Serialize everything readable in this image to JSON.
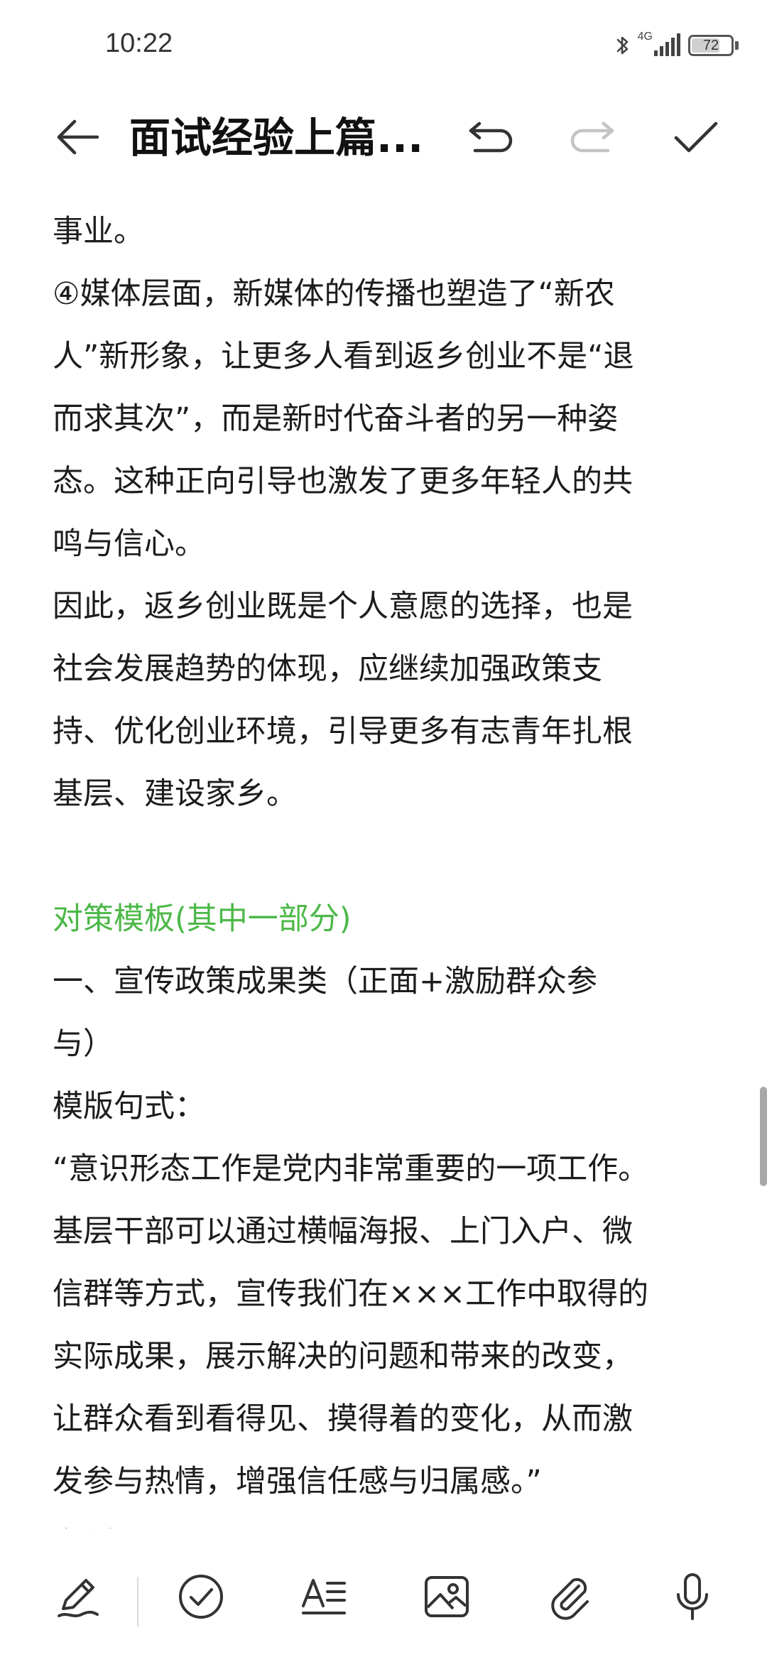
{
  "status_bar": {
    "time": "10:22",
    "network": "4G",
    "battery_level": "72",
    "battery_fraction": 0.72
  },
  "title_bar": {
    "title": "面试经验上篇..."
  },
  "content": {
    "lines": [
      {
        "text": "事业。",
        "style": "normal"
      },
      {
        "text": "④媒体层面，新媒体的传播也塑造了“新农",
        "style": "normal"
      },
      {
        "text": "人”新形象，让更多人看到返乡创业不是“退",
        "style": "normal"
      },
      {
        "text": "而求其次”，而是新时代奋斗者的另一种姿",
        "style": "normal"
      },
      {
        "text": "态。这种正向引导也激发了更多年轻人的共",
        "style": "normal"
      },
      {
        "text": "鸣与信心。",
        "style": "normal"
      },
      {
        "text": "因此，返乡创业既是个人意愿的选择，也是",
        "style": "normal"
      },
      {
        "text": "社会发展趋势的体现，应继续加强政策支",
        "style": "normal"
      },
      {
        "text": "持、优化创业环境，引导更多有志青年扎根",
        "style": "normal"
      },
      {
        "text": "基层、建设家乡。",
        "style": "normal"
      },
      {
        "text": "",
        "style": "blank"
      },
      {
        "text": "对策模板(其中一部分)",
        "style": "heading"
      },
      {
        "text": "一、宣传政策成果类（正面+激励群众参",
        "style": "normal"
      },
      {
        "text": "与）",
        "style": "normal"
      },
      {
        "text": "模版句式：",
        "style": "normal"
      },
      {
        "text": "“意识形态工作是党内非常重要的一项工作。",
        "style": "normal"
      },
      {
        "text": "基层干部可以通过横幅海报、上门入户、微",
        "style": "normal"
      },
      {
        "text": "信群等方式，宣传我们在×××工作中取得的",
        "style": "normal"
      },
      {
        "text": "实际成果，展示解决的问题和带来的改变，",
        "style": "normal"
      },
      {
        "text": "让群众看到看得见、摸得着的变化，从而激",
        "style": "normal"
      },
      {
        "text": "发参与热情，增强信任感与归属感。”",
        "style": "normal"
      },
      {
        "text": "举例：",
        "style": "normal"
      }
    ]
  },
  "colors": {
    "heading": "#4cb848",
    "text": "#1c1c1c",
    "icon": "#333333",
    "icon_disabled": "#c4c4c4"
  },
  "icons": {
    "back": "arrow-left-icon",
    "undo": "undo-icon",
    "redo": "redo-icon",
    "done": "check-icon",
    "pen": "pen-icon",
    "checklist": "check-circle-icon",
    "text_format": "text-format-icon",
    "image": "image-icon",
    "attachment": "paperclip-icon",
    "mic": "microphone-icon"
  }
}
